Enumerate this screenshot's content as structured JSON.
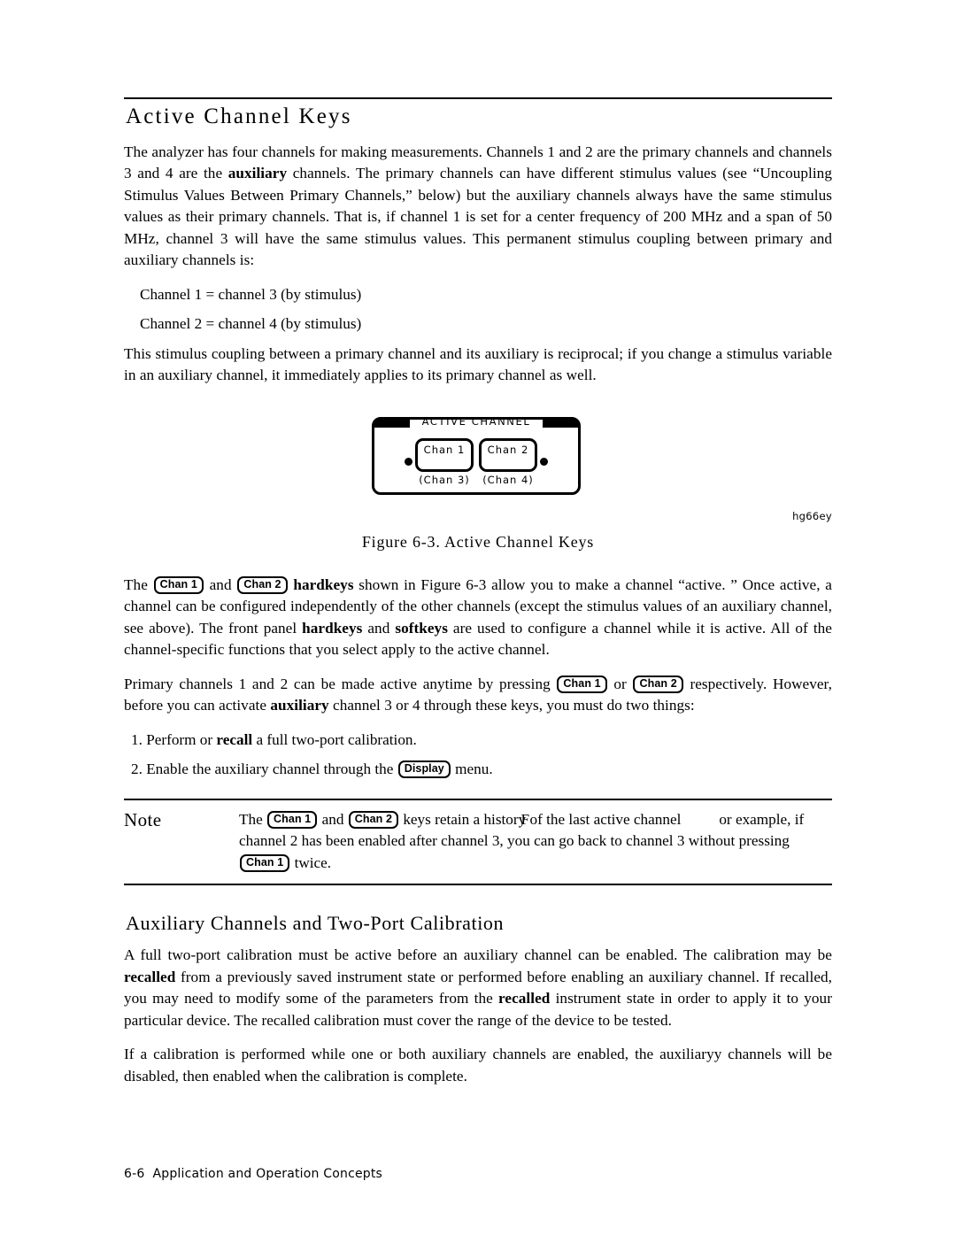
{
  "page": {
    "heading": "Active Channel Keys",
    "footer": {
      "page_number": "6-6",
      "label": "Application and Operation Concepts"
    }
  },
  "intro": {
    "p1_a": "The analyzer has four channels for making measurements. Channels 1 and 2 are the primary channels and channels 3 and 4 are the ",
    "p1_bold": "auxiliary",
    "p1_b": " channels. The primary channels can have different stimulus values (see “Uncoupling Stimulus Values Between Primary Channels,” below) but the auxiliary channels always have the same stimulus values as their primary channels. That is, if channel 1 is set for a center frequency of 200 MHz and a span of 50 MHz, channel 3 will have the same stimulus values. This permanent stimulus coupling between primary and auxiliary channels is:",
    "coupling_1": "Channel 1 = channel 3 (by stimulus)",
    "coupling_2": "Channel 2 = channel 4 (by stimulus)",
    "p2": "This stimulus coupling between a primary channel and its auxiliary is reciprocal; if you change a stimulus variable in an auxiliary channel, it immediately applies to its primary channel as well."
  },
  "figure": {
    "panel_title": "ACTIVE CHANNEL",
    "key1": "Chan 1",
    "key2": "Chan 2",
    "sub1": "(Chan 3)",
    "sub2": "(Chan 4)",
    "figure_id": "hg66ey",
    "caption": "Figure 6-3. Active Channel Keys"
  },
  "after_figure": {
    "p1_a": "The ",
    "key_chan1": "Chan 1",
    "p1_b": " and ",
    "key_chan2": "Chan 2",
    "p1_bold_hardkeys": " hardkeys",
    "p1_c": " shown in Figure 6-3 allow you to make a channel “active. ” Once active, a channel can be configured independently of the other channels (except the stimulus values of an auxiliary channel, see above). The front panel ",
    "p1_bold2": "hardkeys",
    "p1_d": " and ",
    "p1_bold3": "softkeys",
    "p1_e": " are used to configure a channel while it is active. All of the channel-specific functions that you select apply to the active channel.",
    "p2_a": "Primary channels 1 and 2 can be made active anytime by pressing ",
    "p2_b": " or ",
    "p2_c": " respectively. However, before you can activate ",
    "p2_bold": "auxiliary",
    "p2_d": " channel 3 or 4 through these keys, you must do two things:",
    "step1_a": "1. Perform or ",
    "step1_bold": "recall",
    "step1_b": " a full two-port calibration.",
    "step2_a": "2. Enable the auxiliary channel through the ",
    "step2_key": "Display",
    "step2_b": " menu."
  },
  "note": {
    "label": "Note",
    "t_a": "The ",
    "key1": "Chan 1",
    "t_b": " and ",
    "key2": "Chan 2",
    "t_c": " keys retain a his",
    "t_overlap_under": "tory",
    "t_overlap_over": "F",
    "t_d": " of the last active channel",
    "t_e": "or example, if channel 2 has been enabled after channel 3, you can go back to channel 3 without pressing ",
    "key3": "Chan 1",
    "t_f": " twice."
  },
  "auxiliary_section": {
    "heading": "Auxiliary Channels and Two-Port Calibration",
    "p1_a": "A full two-port calibration must be active before an auxiliary channel can be enabled. The calibration may be ",
    "p1_bold1": "recalled",
    "p1_b": " from a previously saved instrument state or performed before enabling an auxiliary channel. If recalled, you may need to modify some of the parameters from the ",
    "p1_bold2": "recalled",
    "p1_c": " instrument state in order to apply it to your particular device. The recalled calibration must cover the range of the device to be tested.",
    "p2": "If a calibration is performed while one or both auxiliary channels are enabled, the auxiliaryy channels will be disabled, then enabled when the calibration is complete."
  }
}
